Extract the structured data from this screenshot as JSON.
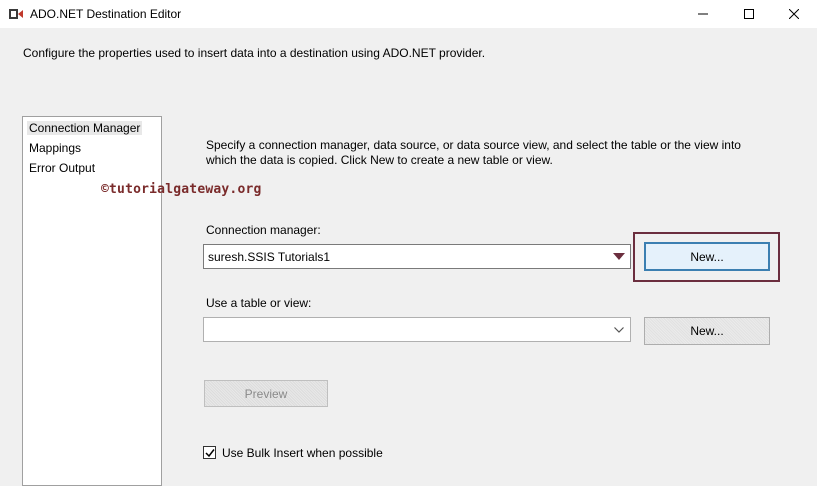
{
  "window": {
    "title": "ADO.NET Destination Editor",
    "icon": "ssis-destination-icon"
  },
  "description": "Configure the properties used to insert data into a destination using ADO.NET provider.",
  "nav": {
    "items": [
      {
        "label": "Connection Manager",
        "selected": true
      },
      {
        "label": "Mappings",
        "selected": false
      },
      {
        "label": "Error Output",
        "selected": false
      }
    ]
  },
  "instructions": {
    "line1": "Specify a connection manager, data source, or data source view, and select the table or the view into",
    "line2": "which the data is copied. Click New to create a new table or view."
  },
  "watermark": "©tutorialgateway.org",
  "connection_manager": {
    "label": "Connection manager:",
    "value": "suresh.SSIS Tutorials1",
    "new_button": "New..."
  },
  "table_view": {
    "label": "Use a table or view:",
    "value": "",
    "new_button": "New..."
  },
  "preview_button": "Preview",
  "bulk_insert": {
    "label": "Use Bulk Insert when possible",
    "checked": true
  },
  "colors": {
    "highlight": "#6b2e3e",
    "watermark": "#7a2b2b",
    "active_button_border": "#3c7fb1"
  }
}
